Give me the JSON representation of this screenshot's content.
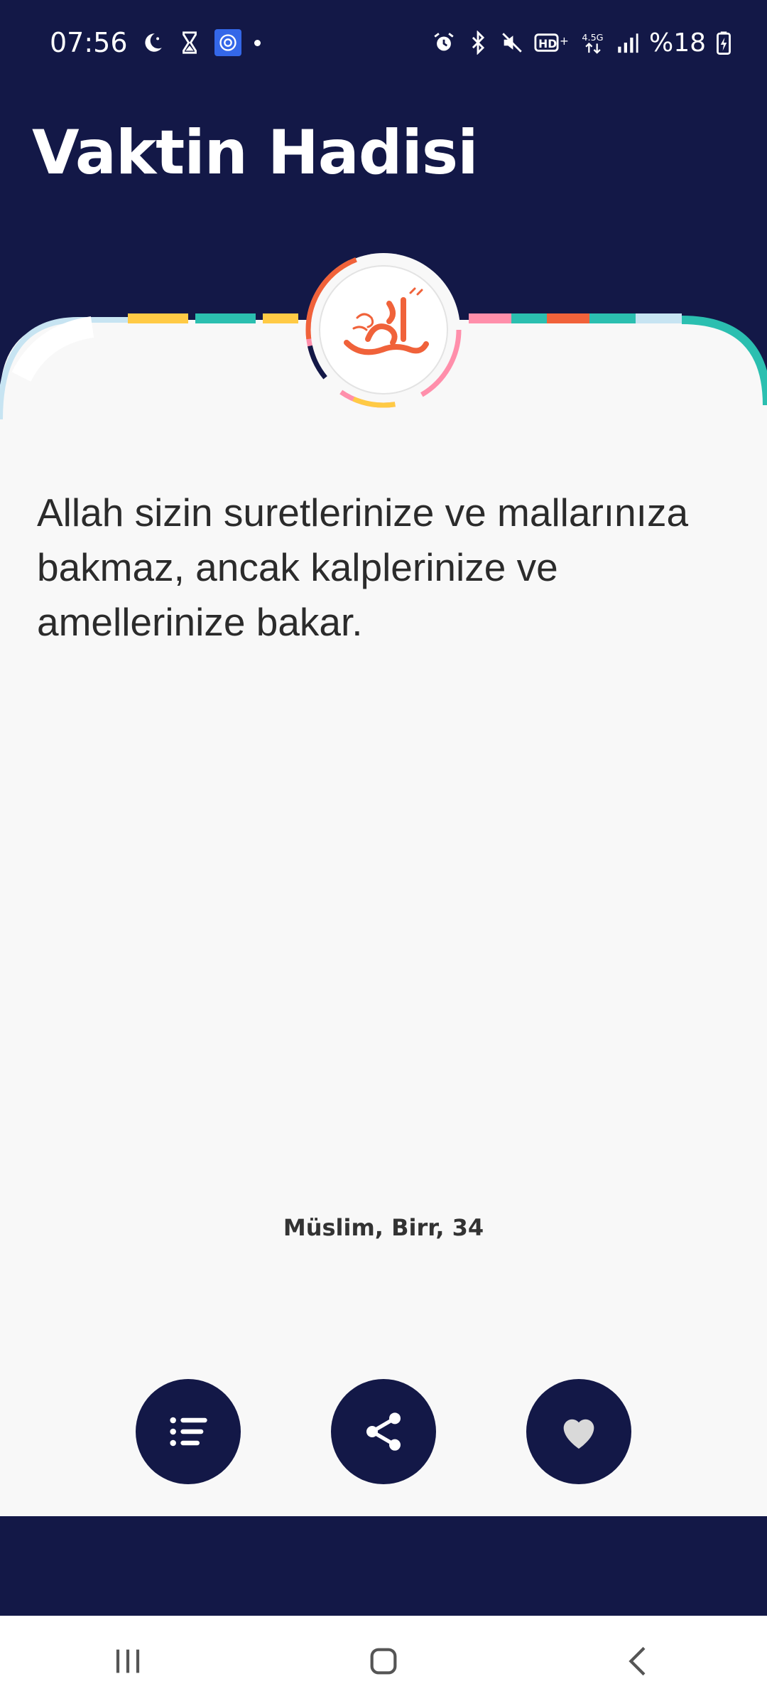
{
  "status_bar": {
    "time": "07:56",
    "battery": "%18",
    "icons_left": [
      "moon-icon",
      "hourglass-icon",
      "app-badge-icon",
      "dot-icon"
    ],
    "icons_right": [
      "alarm-icon",
      "bluetooth-icon",
      "mute-icon",
      "hd-volte-icon",
      "network-4-5g-icon",
      "signal-icon",
      "battery-charging-icon"
    ],
    "network_label": "4.5G"
  },
  "header": {
    "title": "Vaktin Hadisi",
    "background_color": "#131847"
  },
  "emblem": {
    "name": "muhammad-calligraphy-icon",
    "accent_color": "#f0623a"
  },
  "hadith": {
    "text": "Allah sizin suretlerinize ve mallarınıza bakmaz, ancak kalplerinize ve amellerinize bakar.",
    "source": "Müslim, Birr, 34"
  },
  "actions": [
    {
      "name": "list-button",
      "icon": "list-icon"
    },
    {
      "name": "share-button",
      "icon": "share-icon"
    },
    {
      "name": "favorite-button",
      "icon": "heart-icon"
    }
  ],
  "nav": {
    "items": [
      "recent-apps-icon",
      "home-icon",
      "back-icon"
    ]
  }
}
